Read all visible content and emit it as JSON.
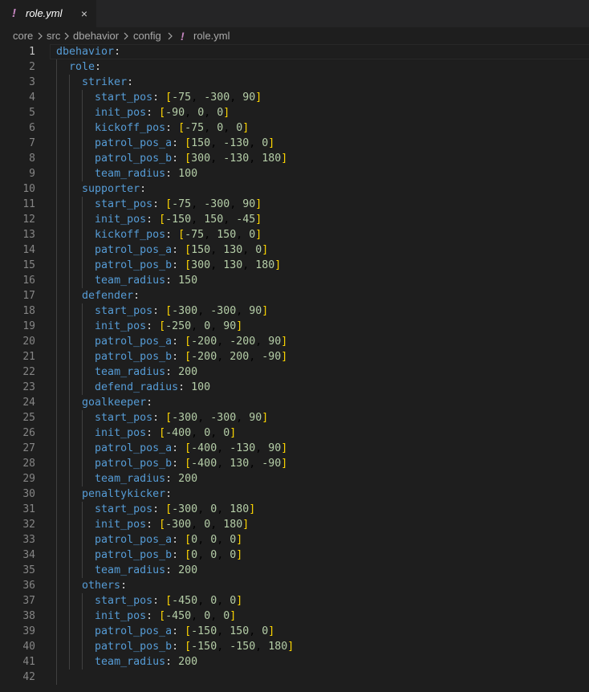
{
  "tab": {
    "mark": "!",
    "label": "role.yml",
    "close": "×"
  },
  "breadcrumb": {
    "items": [
      "core",
      "src",
      "dbehavior",
      "config"
    ],
    "mark": "!",
    "file": "role.yml"
  },
  "editor": {
    "language": "yaml",
    "active_line": 1,
    "colors": {
      "key": "#569cd6",
      "number": "#b5cea8",
      "bracket": "#ffd700",
      "punct": "#d4d4d4",
      "line_number": "#858585"
    },
    "lines": [
      {
        "n": "1",
        "t": "dbehavior:"
      },
      {
        "n": "2",
        "t": "  role:"
      },
      {
        "n": "3",
        "t": "    striker:"
      },
      {
        "n": "4",
        "t": "      start_pos: [-75, -300, 90]"
      },
      {
        "n": "5",
        "t": "      init_pos: [-90, 0, 0]"
      },
      {
        "n": "6",
        "t": "      kickoff_pos: [-75, 0, 0]"
      },
      {
        "n": "7",
        "t": "      patrol_pos_a: [150, -130, 0]"
      },
      {
        "n": "8",
        "t": "      patrol_pos_b: [300, -130, 180]"
      },
      {
        "n": "9",
        "t": "      team_radius: 100"
      },
      {
        "n": "10",
        "t": "    supporter:"
      },
      {
        "n": "11",
        "t": "      start_pos: [-75, -300, 90]"
      },
      {
        "n": "12",
        "t": "      init_pos: [-150, 150, -45]"
      },
      {
        "n": "13",
        "t": "      kickoff_pos: [-75, 150, 0]"
      },
      {
        "n": "14",
        "t": "      patrol_pos_a: [150, 130, 0]"
      },
      {
        "n": "15",
        "t": "      patrol_pos_b: [300, 130, 180]"
      },
      {
        "n": "16",
        "t": "      team_radius: 150"
      },
      {
        "n": "17",
        "t": "    defender:"
      },
      {
        "n": "18",
        "t": "      start_pos: [-300, -300, 90]"
      },
      {
        "n": "19",
        "t": "      init_pos: [-250, 0, 90]"
      },
      {
        "n": "20",
        "t": "      patrol_pos_a: [-200, -200, 90]"
      },
      {
        "n": "21",
        "t": "      patrol_pos_b: [-200, 200, -90]"
      },
      {
        "n": "22",
        "t": "      team_radius: 200"
      },
      {
        "n": "23",
        "t": "      defend_radius: 100"
      },
      {
        "n": "24",
        "t": "    goalkeeper:"
      },
      {
        "n": "25",
        "t": "      start_pos: [-300, -300, 90]"
      },
      {
        "n": "26",
        "t": "      init_pos: [-400, 0, 0]"
      },
      {
        "n": "27",
        "t": "      patrol_pos_a: [-400, -130, 90]"
      },
      {
        "n": "28",
        "t": "      patrol_pos_b: [-400, 130, -90]"
      },
      {
        "n": "29",
        "t": "      team_radius: 200"
      },
      {
        "n": "30",
        "t": "    penaltykicker:"
      },
      {
        "n": "31",
        "t": "      start_pos: [-300, 0, 180]"
      },
      {
        "n": "32",
        "t": "      init_pos: [-300, 0, 180]"
      },
      {
        "n": "33",
        "t": "      patrol_pos_a: [0, 0, 0]"
      },
      {
        "n": "34",
        "t": "      patrol_pos_b: [0, 0, 0]"
      },
      {
        "n": "35",
        "t": "      team_radius: 200"
      },
      {
        "n": "36",
        "t": "    others:"
      },
      {
        "n": "37",
        "t": "      start_pos: [-450, 0, 0]"
      },
      {
        "n": "38",
        "t": "      init_pos: [-450, 0, 0]"
      },
      {
        "n": "39",
        "t": "      patrol_pos_a: [-150, 150, 0]"
      },
      {
        "n": "40",
        "t": "      patrol_pos_b: [-150, -150, 180]"
      },
      {
        "n": "41",
        "t": "      team_radius: 200"
      },
      {
        "n": "42",
        "t": ""
      }
    ]
  }
}
